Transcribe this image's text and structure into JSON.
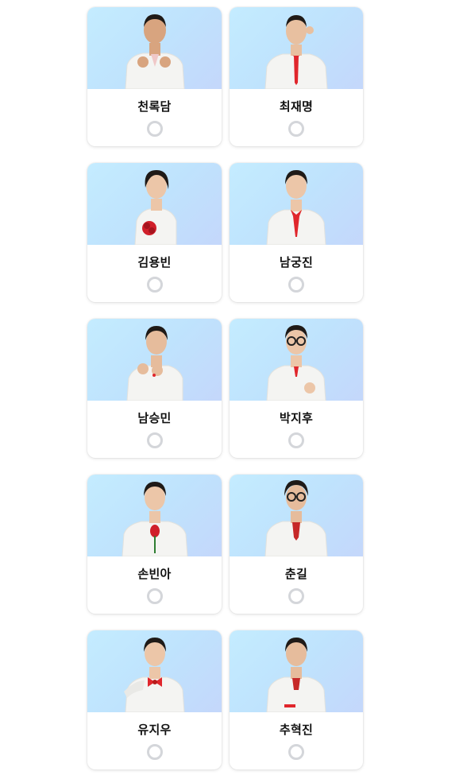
{
  "candidates": [
    {
      "name": "천록담"
    },
    {
      "name": "최재명"
    },
    {
      "name": "김용빈"
    },
    {
      "name": "남궁진"
    },
    {
      "name": "남승민"
    },
    {
      "name": "박지후"
    },
    {
      "name": "손빈아"
    },
    {
      "name": "춘길"
    },
    {
      "name": "유지우"
    },
    {
      "name": "추혁진"
    }
  ],
  "colors": {
    "photo_bg": "#c4e4fd",
    "suit": "#f4f4f2",
    "accent_red": "#e0262c",
    "radio_ring": "#d4d6da"
  }
}
